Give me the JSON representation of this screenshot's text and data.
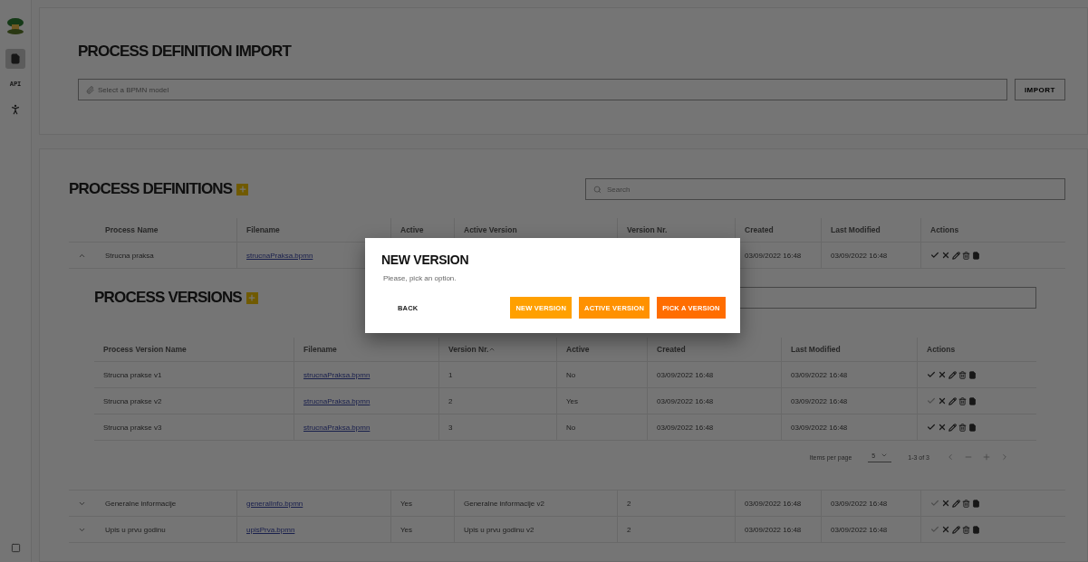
{
  "sidebar": {
    "items": [
      {
        "kind": "document",
        "selected": true
      },
      {
        "kind": "label",
        "label": "API",
        "selected": false
      },
      {
        "kind": "person",
        "selected": false
      }
    ]
  },
  "import_card": {
    "title": "PROCESS DEFINITION IMPORT",
    "file_field": {
      "placeholder": "Select a BPMN model"
    },
    "button": "IMPORT"
  },
  "definitions": {
    "title": "PROCESS DEFINITIONS",
    "search": {
      "placeholder": "Search"
    },
    "columns": [
      "Process Name",
      "Filename",
      "Active",
      "Active Version",
      "Version Nr.",
      "Created",
      "Last Modified",
      "Actions"
    ],
    "rows": [
      {
        "expanded": true,
        "name": "Strucna praksa",
        "filename": "strucnaPraksa.bpmn",
        "active": "",
        "active_version": "",
        "version_nr": "",
        "created": "03/09/2022 16:48",
        "modified": "03/09/2022 16:48",
        "check_enabled": true
      },
      {
        "expanded": false,
        "name": "Generalne informacije",
        "filename": "generalInfo.bpmn",
        "active": "Yes",
        "active_version": "Generalne informacije v2",
        "version_nr": "2",
        "created": "03/09/2022 16:48",
        "modified": "03/09/2022 16:48",
        "check_enabled": false
      },
      {
        "expanded": false,
        "name": "Upis u prvu godinu",
        "filename": "upisPrva.bpmn",
        "active": "Yes",
        "active_version": "Upis u prvu godinu v2",
        "version_nr": "2",
        "created": "03/09/2022 16:48",
        "modified": "03/09/2022 16:48",
        "check_enabled": false
      }
    ]
  },
  "versions": {
    "title": "PROCESS VERSIONS",
    "columns": [
      "Process Version Name",
      "Filename",
      "Version Nr.",
      "Active",
      "Created",
      "Last Modified",
      "Actions"
    ],
    "rows": [
      {
        "name": "Strucna prakse v1",
        "filename": "strucnaPraksa.bpmn",
        "version_nr": "1",
        "active": "No",
        "created": "03/09/2022 16:48",
        "modified": "03/09/2022 16:48",
        "check_enabled": true
      },
      {
        "name": "Strucna prakse v2",
        "filename": "strucnaPraksa.bpmn",
        "version_nr": "2",
        "active": "Yes",
        "created": "03/09/2022 16:48",
        "modified": "03/09/2022 16:48",
        "check_enabled": false
      },
      {
        "name": "Strucna prakse v3",
        "filename": "strucnaPraksa.bpmn",
        "version_nr": "3",
        "active": "No",
        "created": "03/09/2022 16:48",
        "modified": "03/09/2022 16:48",
        "check_enabled": true
      }
    ],
    "paginator": {
      "label": "Items per page",
      "page_size": "5",
      "range": "1-3 of 3"
    }
  },
  "dialog": {
    "title": "NEW VERSION",
    "message": "Please, pick an option.",
    "buttons": [
      {
        "kind": "text",
        "label": "BACK"
      },
      {
        "kind": "filled",
        "label": "NEW VERSION",
        "color": "#ffa000"
      },
      {
        "kind": "filled",
        "label": "ACTIVE VERSION",
        "color": "#ff9100"
      },
      {
        "kind": "filled",
        "label": "PICK A VERSION",
        "color": "#ff6d00"
      }
    ]
  }
}
